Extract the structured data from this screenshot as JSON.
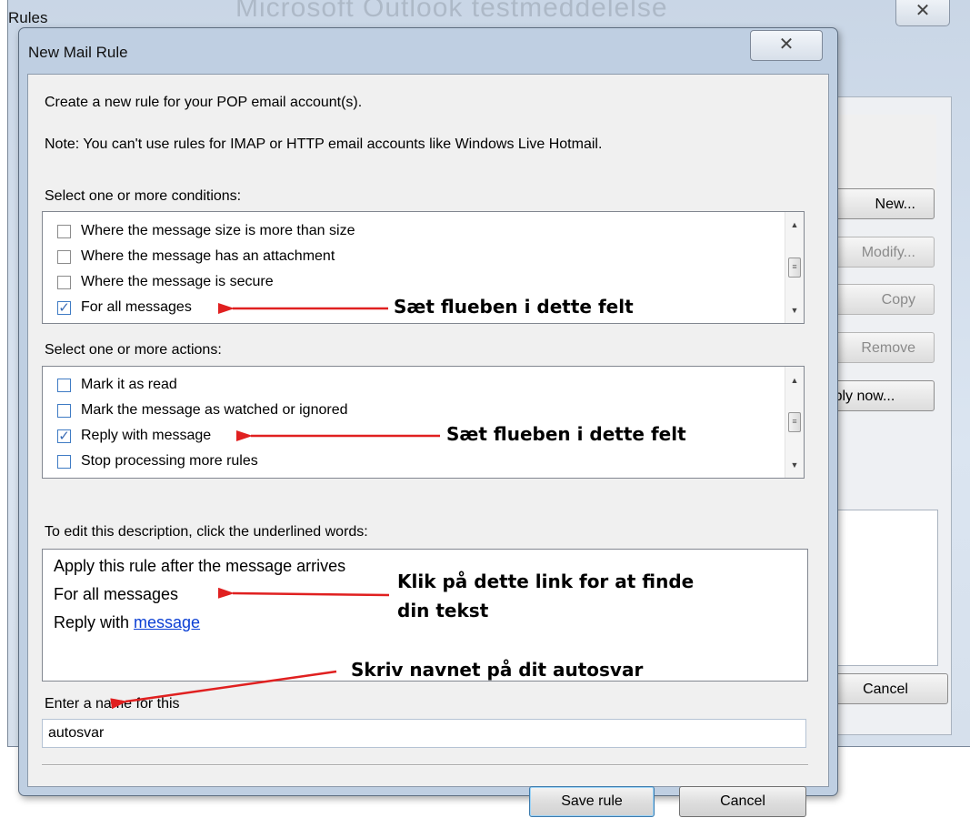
{
  "background_window": {
    "title": "Rules",
    "ghost_title": "Microsoft Outlook testmeddelelse",
    "close_glyph": "✕",
    "buttons": {
      "new": "New...",
      "modify": "Modify...",
      "copy": "Copy",
      "remove": "Remove",
      "apply_now": "Apply now...",
      "cancel": "Cancel"
    }
  },
  "dialog": {
    "title": "New Mail Rule",
    "close_glyph": "✕",
    "intro": "Create a new rule for your POP email account(s).",
    "note": "Note: You can't use rules for IMAP or HTTP email accounts like Windows Live Hotmail.",
    "conditions_label": "Select one or more conditions:",
    "conditions": [
      {
        "label": "Where the message size is more than size",
        "checked": false
      },
      {
        "label": "Where the message has an attachment",
        "checked": false
      },
      {
        "label": "Where the message is secure",
        "checked": false
      },
      {
        "label": "For all messages",
        "checked": true
      }
    ],
    "actions_label": "Select one or more actions:",
    "actions": [
      {
        "label": "Mark it as read",
        "checked": false
      },
      {
        "label": "Mark the message as watched or ignored",
        "checked": false
      },
      {
        "label": "Reply with message",
        "checked": true
      },
      {
        "label": "Stop processing more rules",
        "checked": false
      }
    ],
    "description_label": "To edit this description, click the underlined words:",
    "description": {
      "line1": "Apply this rule after the message arrives",
      "line2": "For all messages",
      "line3_prefix": "Reply with ",
      "line3_link": "message"
    },
    "name_label": "Enter a name for this",
    "name_value": "autosvar",
    "save_button": "Save rule",
    "cancel_button": "Cancel"
  },
  "annotations": {
    "conditions_note": "Sæt flueben i dette felt",
    "actions_note": "Sæt flueben i dette felt",
    "link_note_line1": "Klik på dette link for at finde",
    "link_note_line2": "din tekst",
    "name_note": "Skriv navnet på dit autosvar",
    "arrow_color": "#e02020"
  },
  "glyphs": {
    "check": "✓",
    "scroll_up": "▲",
    "scroll_down": "▼",
    "thumb_grip": "≡"
  }
}
